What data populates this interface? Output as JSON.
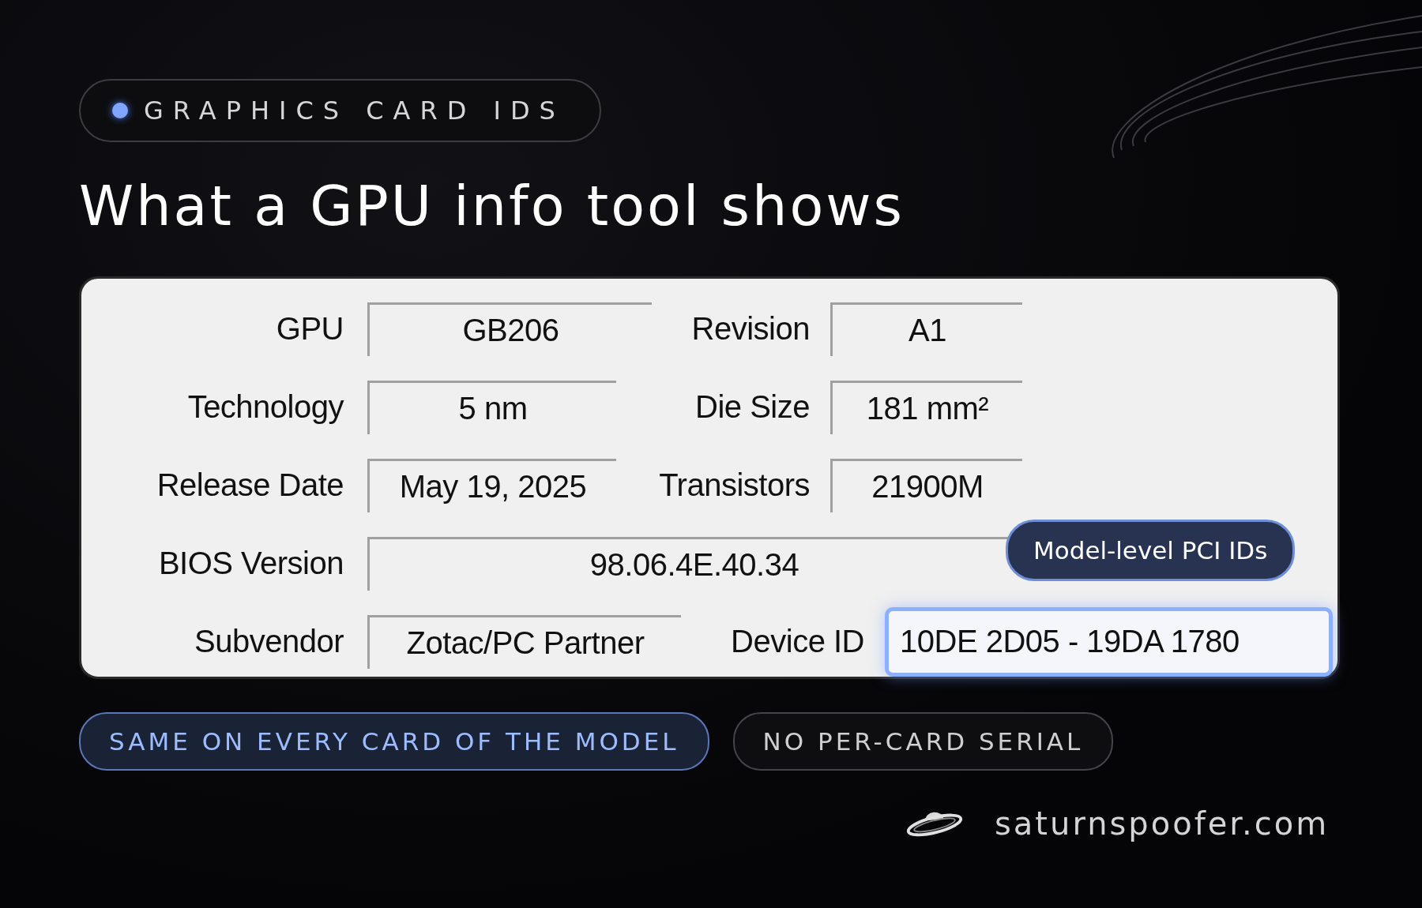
{
  "badge": {
    "label": "GRAPHICS CARD IDS"
  },
  "title": "What a GPU info tool shows",
  "panel": {
    "rows": [
      {
        "fields": [
          {
            "label": "GPU",
            "value": "GB206",
            "highlighted": false
          },
          {
            "label": "Revision",
            "value": "A1",
            "highlighted": false
          }
        ]
      },
      {
        "fields": [
          {
            "label": "Technology",
            "value": "5 nm",
            "highlighted": false
          },
          {
            "label": "Die Size",
            "value": "181 mm²",
            "highlighted": false
          }
        ]
      },
      {
        "fields": [
          {
            "label": "Release Date",
            "value": "May 19, 2025",
            "highlighted": false
          },
          {
            "label": "Transistors",
            "value": "21900M",
            "highlighted": false
          }
        ]
      },
      {
        "fields": [
          {
            "label": "BIOS Version",
            "value": "98.06.4E.40.34",
            "highlighted": false
          }
        ]
      },
      {
        "fields": [
          {
            "label": "Subvendor",
            "value": "Zotac/PC Partner",
            "highlighted": false
          },
          {
            "label": "Device ID",
            "value": "10DE 2D05 - 19DA 1780",
            "highlighted": true
          }
        ]
      }
    ]
  },
  "tooltip": "Model-level PCI IDs",
  "chips": [
    {
      "label": "SAME ON EVERY CARD OF THE MODEL",
      "highlighted": true
    },
    {
      "label": "NO PER-CARD SERIAL",
      "highlighted": false
    }
  ],
  "footer": {
    "site": "saturnspoofer.com"
  }
}
